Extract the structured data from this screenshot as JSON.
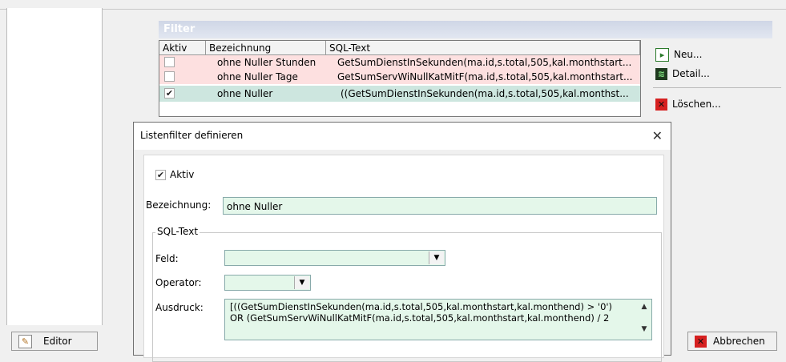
{
  "filter": {
    "header": "Filter",
    "columns": [
      "Aktiv",
      "Bezeichnung",
      "SQL-Text"
    ],
    "rows": [
      {
        "checked": false,
        "name": "ohne Nuller Stunden",
        "sql": "GetSumDienstInSekunden(ma.id,s.total,505,kal.monthstart...",
        "bg": "#fde0e0"
      },
      {
        "checked": false,
        "name": "ohne Nuller Tage",
        "sql": "GetSumServWiNullKatMitF(ma.id,s.total,505,kal.monthstart...",
        "bg": "#fde0e0"
      },
      {
        "checked": true,
        "name": "ohne Nuller",
        "sql": "((GetSumDienstInSekunden(ma.id,s.total,505,kal.monthst...",
        "bg": "#cde6df"
      }
    ]
  },
  "right_buttons": {
    "neu": "Neu...",
    "detail": "Detail...",
    "loeschen": "Löschen..."
  },
  "bottom": {
    "editor": "Editor",
    "abbrechen": "Abbrechen"
  },
  "dialog": {
    "title": "Listenfilter definieren",
    "aktiv_label": "Aktiv",
    "aktiv_checked": true,
    "bezeichnung_label": "Bezeichnung:",
    "bezeichnung_value": "ohne Nuller",
    "sql_group_label": "SQL-Text",
    "feld_label": "Feld:",
    "feld_value": "",
    "operator_label": "Operator:",
    "operator_value": "",
    "ausdruck_label": "Ausdruck:",
    "ausdruck_line1": "[((GetSumDienstInSekunden(ma.id,s.total,505,kal.monthstart,kal.monthend) > '0')",
    "ausdruck_line2": "OR (GetSumServWiNullKatMitF(ma.id,s.total,505,kal.monthstart,kal.monthend) / 2"
  },
  "colors": {
    "accent_green": "#e4f7ea",
    "row_pink": "#fde0e0",
    "row_selected": "#cde6df",
    "delete_red": "#d62020"
  }
}
